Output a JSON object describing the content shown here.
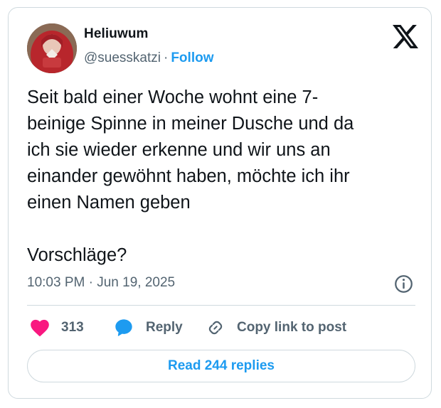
{
  "author": {
    "display_name": "Heliuwum",
    "handle": "@suesskatzi",
    "separator": "·",
    "follow_label": "Follow"
  },
  "tweet": {
    "text": "Seit bald einer Woche wohnt eine 7-\nbeinige Spinne in meiner Dusche und da\nich sie wieder erkenne und wir uns an\neinander gewöhnt haben, möchte ich ihr\neinen Namen geben\n\nVorschläge?",
    "timestamp": "10:03 PM · Jun 19, 2025"
  },
  "actions": {
    "like_count": "313",
    "reply_label": "Reply",
    "copy_link_label": "Copy link to post"
  },
  "read_replies_label": "Read 244 replies",
  "icons": {
    "brand": "x-logo-icon",
    "info": "info-icon",
    "like": "heart-icon",
    "reply": "reply-bubble-icon",
    "copy": "link-icon"
  },
  "colors": {
    "accent": "#1d9bf0",
    "like": "#f91880",
    "text": "#0f1419",
    "secondary_text": "#536471",
    "border": "#cfd9de"
  }
}
